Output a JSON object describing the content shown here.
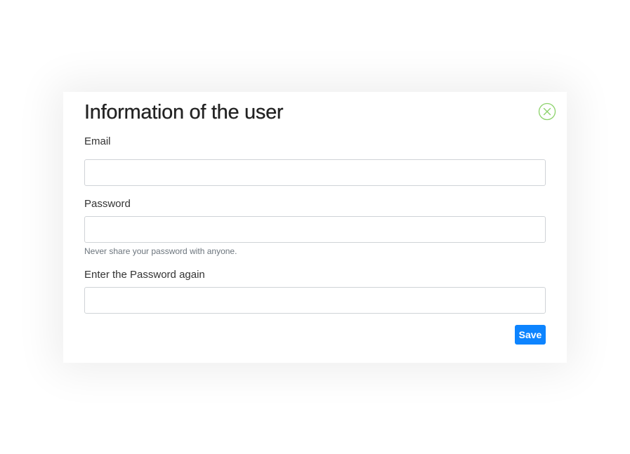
{
  "dialog": {
    "title": "Information of the user",
    "close_icon": "close-circle-icon",
    "fields": {
      "email": {
        "label": "Email",
        "value": "",
        "placeholder": ""
      },
      "password": {
        "label": "Password",
        "value": "",
        "placeholder": "",
        "help_text": "Never share your password with anyone."
      },
      "password_confirm": {
        "label": "Enter the Password again",
        "value": "",
        "placeholder": ""
      }
    },
    "save_label": "Save"
  },
  "colors": {
    "close_icon": "#8cd26a",
    "primary_button": "#0d84ff",
    "title_text": "#222222",
    "help_text": "#6c757d",
    "input_border": "#cfd3d7"
  }
}
